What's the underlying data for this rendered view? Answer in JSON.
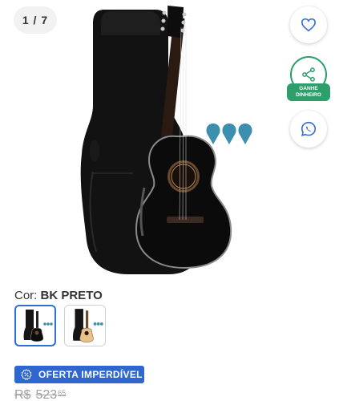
{
  "gallery": {
    "counter": "1 / 7",
    "image_alt": "Violão preto com capa e palhetas"
  },
  "actions": {
    "favorite_icon": "heart-icon",
    "share_icon": "share-icon",
    "earn_line1": "GANHE",
    "earn_line2": "DINHEIRO",
    "whatsapp_icon": "whatsapp-icon"
  },
  "variant": {
    "label": "Cor:",
    "selected": "BK PRETO",
    "options": [
      "BK PRETO",
      "NATURAL"
    ]
  },
  "offer": {
    "badge": "OFERTA IMPERDÍVEL",
    "badge_icon": "discount-icon"
  },
  "price": {
    "currency": "R$",
    "old_whole": "523",
    "old_cents": "65"
  },
  "colors": {
    "accent_blue": "#2f67d2",
    "earn_green": "#2e9e6a",
    "heart_blue": "#3a6fd8"
  }
}
